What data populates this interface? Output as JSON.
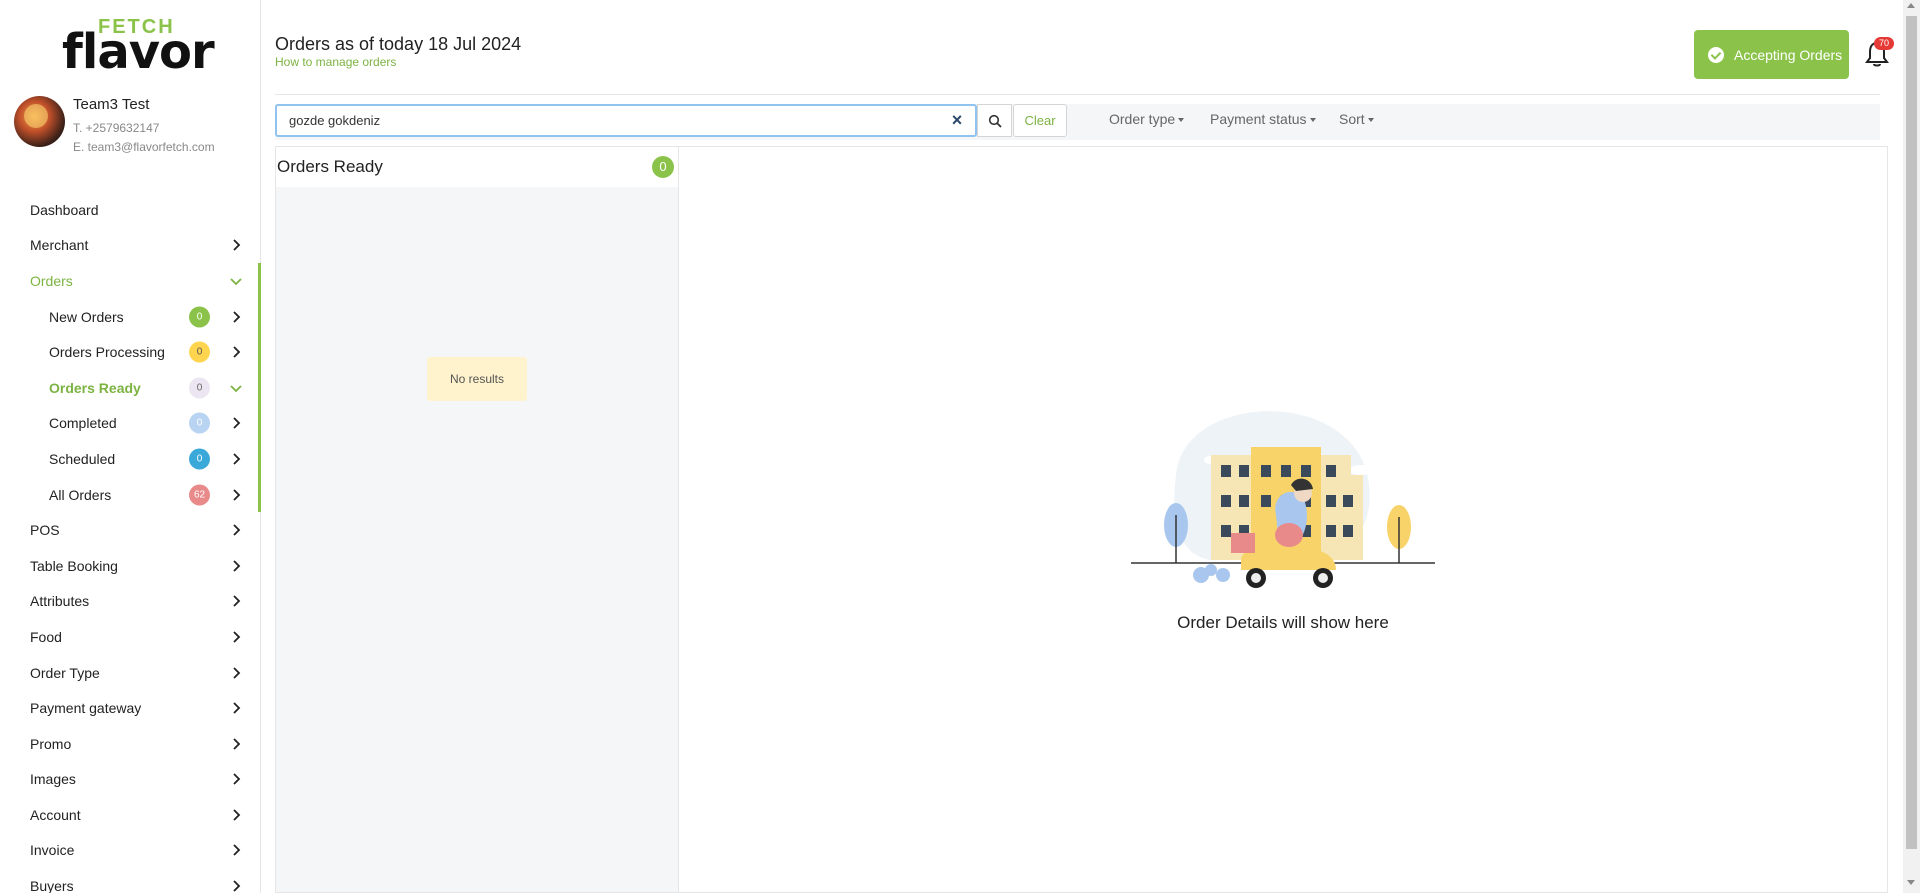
{
  "brand": {
    "logo_top": "FETCH",
    "logo_bottom": "flavor"
  },
  "profile": {
    "name": "Team3 Test",
    "phone": "T. +2579632147",
    "email": "E. team3@flavorfetch.com"
  },
  "sidebar": {
    "items_top": [
      {
        "label": "Dashboard",
        "icon": "none"
      },
      {
        "label": "Merchant",
        "icon": "chevron-right-icon"
      }
    ],
    "orders": {
      "label": "Orders",
      "icon": "chevron-down-icon"
    },
    "orders_sub": [
      {
        "label": "New Orders",
        "count": "0",
        "color": "#8bc34a",
        "icon": "chevron-right-icon"
      },
      {
        "label": "Orders Processing",
        "count": "0",
        "color": "#ffd54f",
        "icon": "chevron-right-icon"
      },
      {
        "label": "Orders Ready",
        "count": "0",
        "color": "#e8e3f0",
        "icon": "chevron-down-icon"
      },
      {
        "label": "Completed",
        "count": "0",
        "color": "#a8c8ee",
        "icon": "chevron-right-icon"
      },
      {
        "label": "Scheduled",
        "count": "0",
        "color": "#3aa8d8",
        "icon": "chevron-right-icon"
      },
      {
        "label": "All Orders",
        "count": "62",
        "color": "#e88a8a",
        "icon": "chevron-right-icon"
      }
    ],
    "items_bottom": [
      {
        "label": "POS"
      },
      {
        "label": "Table Booking"
      },
      {
        "label": "Attributes"
      },
      {
        "label": "Food"
      },
      {
        "label": "Order Type"
      },
      {
        "label": "Payment gateway"
      },
      {
        "label": "Promo"
      },
      {
        "label": "Images"
      },
      {
        "label": "Account"
      },
      {
        "label": "Invoice"
      },
      {
        "label": "Buyers"
      }
    ]
  },
  "header": {
    "title": "Orders as of today 18 Jul 2024",
    "manage_link": "How to manage orders",
    "accepting_label": "Accepting Orders",
    "notification_count": "70"
  },
  "filters": {
    "search_value": "gozde gokdeniz",
    "clear_label": "Clear",
    "order_type": "Order type",
    "payment_status": "Payment status",
    "sort": "Sort"
  },
  "left_panel": {
    "title": "Orders Ready",
    "count": "0",
    "empty_message": "No results"
  },
  "right_panel": {
    "placeholder_text": "Order Details will show here"
  },
  "colors": {
    "accent": "#8bc34a",
    "accent_text": "#7cb342",
    "danger": "#e53935"
  }
}
